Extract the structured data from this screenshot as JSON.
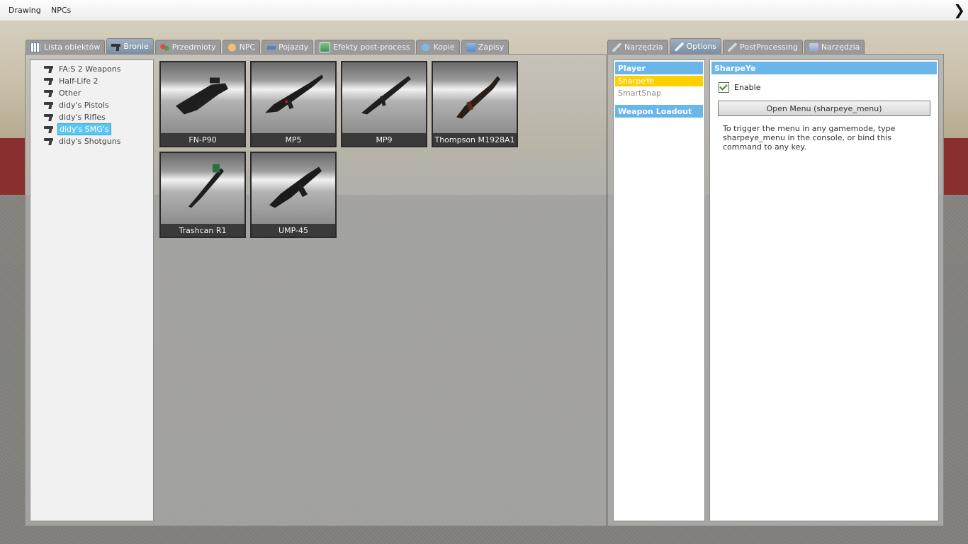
{
  "menubar": {
    "items": [
      "Drawing",
      "NPCs"
    ]
  },
  "spawn_tabs": [
    {
      "label": "Lista obiektów",
      "icon": "grid-icon"
    },
    {
      "label": "Bronie",
      "icon": "gun-icon",
      "active": true
    },
    {
      "label": "Przedmioty",
      "icon": "items-icon"
    },
    {
      "label": "NPC",
      "icon": "npc-icon"
    },
    {
      "label": "Pojazdy",
      "icon": "car-icon"
    },
    {
      "label": "Efekty post-process",
      "icon": "image-icon"
    },
    {
      "label": "Kopie",
      "icon": "dupe-icon"
    },
    {
      "label": "Zapisy",
      "icon": "save-icon"
    }
  ],
  "tree": {
    "items": [
      "FA:S 2 Weapons",
      "Half-Life 2",
      "Other",
      "didy's Pistols",
      "didy's Rifles",
      "didy's SMG's",
      "didy's Shotguns"
    ],
    "selected": "didy's SMG's"
  },
  "weapons": [
    "FN-P90",
    "MP5",
    "MP9",
    "Thompson M1928A1",
    "Trashcan R1",
    "UMP-45"
  ],
  "tool_tabs": [
    {
      "label": "Narzędzia",
      "icon": "wrench-icon"
    },
    {
      "label": "Options",
      "icon": "wrench-icon",
      "active": true
    },
    {
      "label": "PostProcessing",
      "icon": "wrench-icon"
    },
    {
      "label": "Narzędzia",
      "icon": "pencil-icon"
    }
  ],
  "categories": {
    "player_header": "Player",
    "player_items": [
      "SharpeYe",
      "SmartSnap"
    ],
    "selected": "SharpeYe",
    "loadout_header": "Weapon Loadout"
  },
  "options": {
    "title": "SharpeYe",
    "enable_label": "Enable",
    "enable_checked": true,
    "button_label": "Open Menu (sharpeye_menu)",
    "help_text": "To trigger the menu in any gamemode, type sharpeye_menu in the console, or bind this command to any key."
  },
  "colors": {
    "accent_blue": "#6ab6e8",
    "selected_yellow": "#ffd000",
    "tree_selected": "#5cc6f2"
  }
}
